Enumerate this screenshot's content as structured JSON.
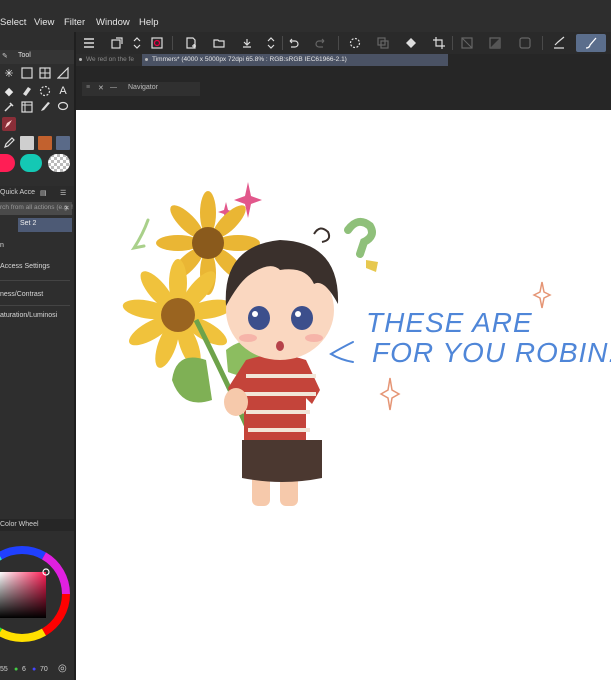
{
  "menu": [
    "Select",
    "View",
    "Filter",
    "Window",
    "Help"
  ],
  "toolbar": {
    "icons": [
      "hamburger-menu-icon",
      "new-layer-icon",
      "up-down-icon",
      "settings-icon",
      "new-file-icon",
      "open-folder-icon",
      "save-icon",
      "export-icon",
      "up-down-icon",
      "undo-icon",
      "redo-icon",
      "loading-icon",
      "copy-icon",
      "fill-icon",
      "crop-icon",
      "transform-icon",
      "selection-icon",
      "square-icon",
      "check-brush-icon",
      "brush-icon"
    ]
  },
  "tabs": {
    "inactive_label": "We red on the fe",
    "active_label": "Timmers* (4000 x 5000px 72dpi 65.8% : RGB:sRGB IEC61966-2.1)"
  },
  "navigator": {
    "title": "Navigator"
  },
  "left_panel": {
    "tool_header": "Tool",
    "quick_access": "Quick Acce",
    "search_placeholder": "rch from all actions (e.g. !",
    "set_label": "Set 2",
    "items": [
      "n",
      "Access Settings",
      "ness/Contrast",
      "aturation/Luminosi"
    ],
    "color_wheel_title": "Color Wheel",
    "color_values": [
      "55",
      "6",
      "70"
    ]
  },
  "colors": {
    "primary": "#ff1e55",
    "secondary": "#14c8b4",
    "accent": "#5b6e8c",
    "active_tab": "#4a5264",
    "selected_tool": "#8a2e38"
  },
  "canvas": {
    "artwork_text_line1": "THESE ARE",
    "artwork_text_line2": "FOR YOU ROBIN!"
  }
}
